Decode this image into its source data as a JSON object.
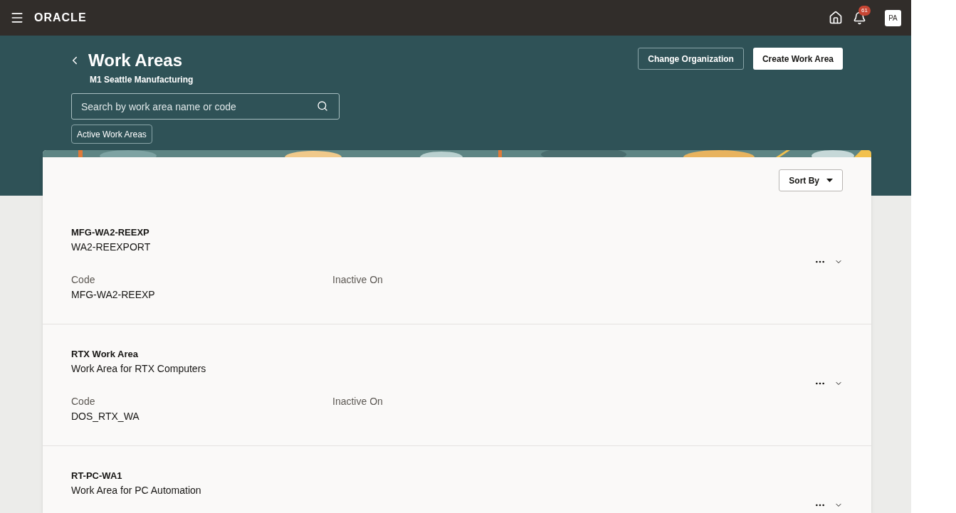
{
  "header": {
    "brand": "ORACLE",
    "notification_count": "61",
    "avatar": "PA"
  },
  "page": {
    "title": "Work Areas",
    "subtitle": "M1 Seattle Manufacturing",
    "search": {
      "placeholder": "Search by work area name or code"
    },
    "filter_chip": "Active Work Areas",
    "buttons": [
      {
        "label": "Change Organization",
        "kind": "secondary"
      },
      {
        "label": "Create Work Area",
        "kind": "primary"
      }
    ]
  },
  "sort_button": "Sort By",
  "work_areas": [
    {
      "name": "MFG-WA2-REEXP",
      "description": "WA2-REEXPORT",
      "fields": [
        {
          "label": "Code",
          "value": "MFG-WA2-REEXP"
        },
        {
          "label": "Inactive On"
        }
      ]
    },
    {
      "name": "RTX Work Area",
      "description": "Work Area for RTX Computers",
      "fields": [
        {
          "label": "Code",
          "value": "DOS_RTX_WA"
        },
        {
          "label": "Inactive On"
        }
      ]
    },
    {
      "name": "RT-PC-WA1",
      "description": "Work Area for PC Automation"
    }
  ]
}
